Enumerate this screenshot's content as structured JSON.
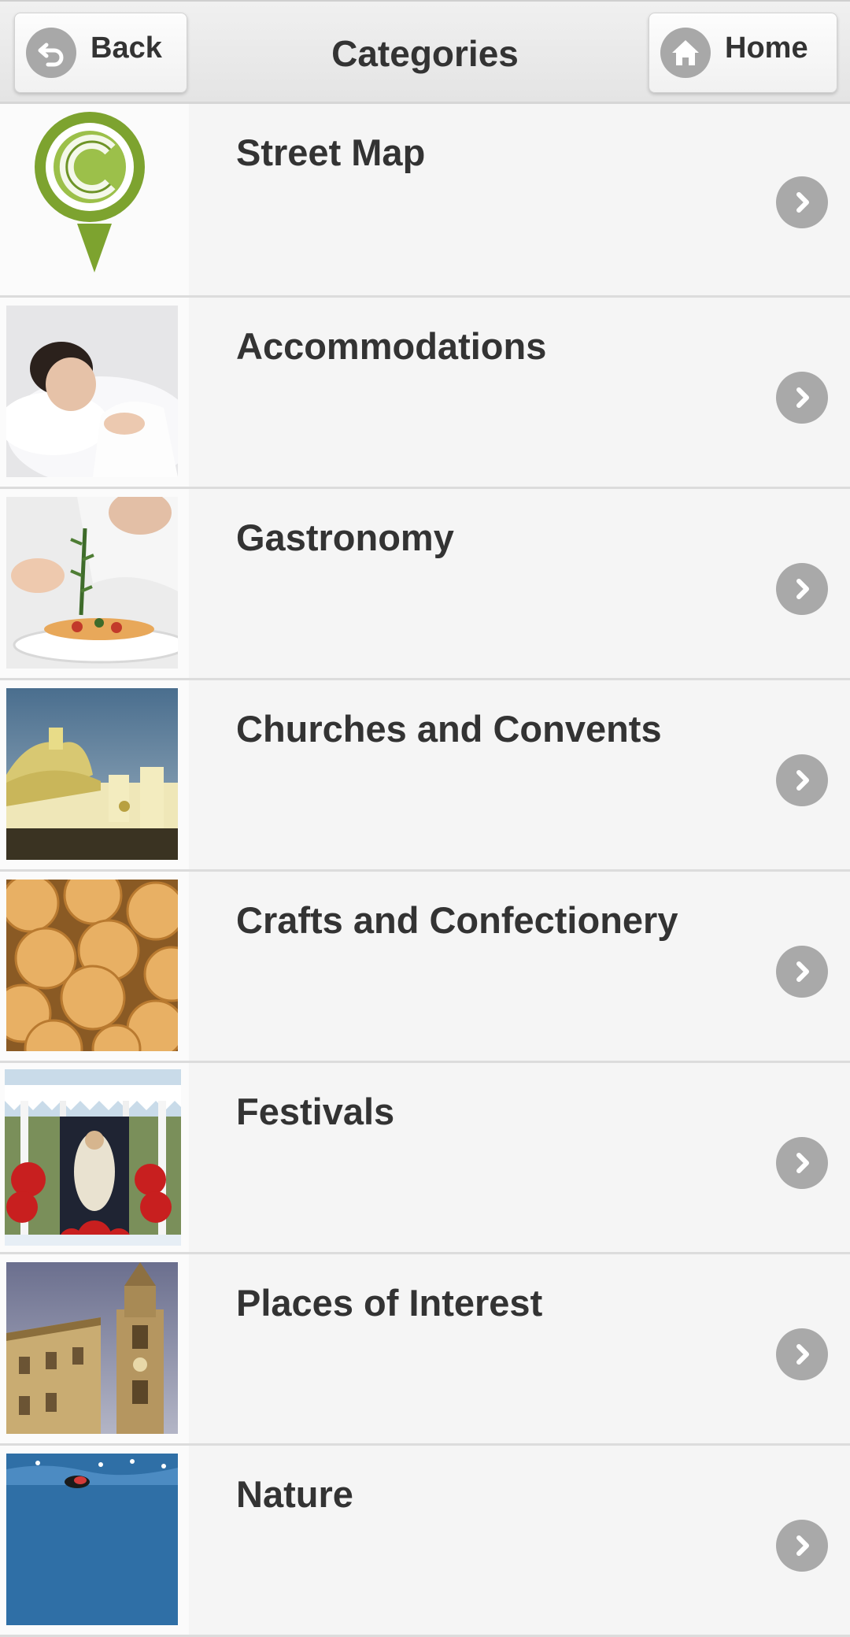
{
  "header": {
    "title": "Categories",
    "back_label": "Back",
    "home_label": "Home"
  },
  "categories": [
    {
      "label": "Street Map",
      "icon": "map-pin-logo-icon"
    },
    {
      "label": "Accommodations",
      "icon": "sleeping-woman-photo"
    },
    {
      "label": "Gastronomy",
      "icon": "chef-plating-photo"
    },
    {
      "label": "Churches and Convents",
      "icon": "church-dome-photo"
    },
    {
      "label": "Crafts and Confectionery",
      "icon": "cookies-photo"
    },
    {
      "label": "Festivals",
      "icon": "festival-float-photo"
    },
    {
      "label": "Places of Interest",
      "icon": "bell-tower-photo"
    },
    {
      "label": "Nature",
      "icon": "nature-water-photo"
    }
  ],
  "colors": {
    "background": "#f5f5f5",
    "chevron": "#a9a9a9",
    "pin_green": "#7da32f",
    "text": "#333333"
  }
}
